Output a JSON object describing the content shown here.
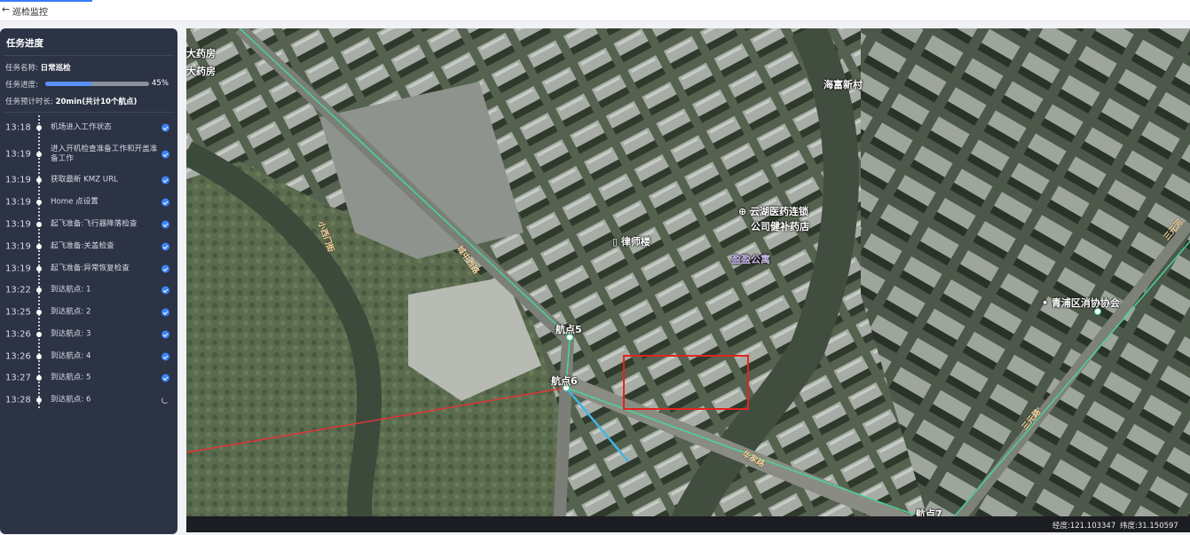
{
  "header": {
    "back_icon": "arrow-left-icon",
    "title": "巡检监控",
    "accent_color": "#3a7bfa"
  },
  "panel": {
    "title": "任务进度",
    "task_name_label": "任务名称:",
    "task_name": "日常巡检",
    "progress_label": "任务进度:",
    "progress_value": 0.45,
    "progress_text": "45%",
    "duration_label": "任务预计时长:",
    "duration_value": "20min(共计10个航点)",
    "steps": [
      {
        "time": "13:18",
        "label": "机场进入工作状态",
        "status": "done"
      },
      {
        "time": "13:19",
        "label": "进入开机检查准备工作和开盖准备工作",
        "status": "done"
      },
      {
        "time": "13:19",
        "label": "获取最新 KMZ URL",
        "status": "done"
      },
      {
        "time": "13:19",
        "label": "Home 点设置",
        "status": "done"
      },
      {
        "time": "13:19",
        "label": "起飞准备:飞行器降落检查",
        "status": "done"
      },
      {
        "time": "13:19",
        "label": "起飞准备:关盖检查",
        "status": "done"
      },
      {
        "time": "13:19",
        "label": "起飞准备:异常恢复检查",
        "status": "done"
      },
      {
        "time": "13:22",
        "label": "到达航点: 1",
        "status": "done"
      },
      {
        "time": "13:25",
        "label": "到达航点: 2",
        "status": "done"
      },
      {
        "time": "13:26",
        "label": "到达航点: 3",
        "status": "done"
      },
      {
        "time": "13:26",
        "label": "到达航点: 4",
        "status": "done"
      },
      {
        "time": "13:27",
        "label": "到达航点: 5",
        "status": "done"
      },
      {
        "time": "13:28",
        "label": "到达航点: 6",
        "status": "in-progress"
      }
    ],
    "check_color": "#3a82f7"
  },
  "map": {
    "poi_labels": {
      "pharmacy_top_left_1": "大药房",
      "pharmacy_top_left_2": "大药房",
      "haiyun_village": "海富新村",
      "yunhu_pharmacy_1": "云湖医药连锁",
      "yunhu_pharmacy_2": "公司健补药店",
      "law_building": "律师楼",
      "apartment": "盈盈公寓",
      "association": "• 青浦区消协协会",
      "waypoint_5": "航点5",
      "waypoint_6": "航点6",
      "waypoint_7": "航点7"
    },
    "road_labels": {
      "road_1": "小西门街",
      "road_2": "城中西路",
      "road_3": "华家路",
      "road_4": "三元河",
      "road_5": "三元路"
    },
    "route_colors": {
      "planned": "#49d49a",
      "flown": "#e03535",
      "heading": "#41b6e6"
    },
    "target_color": "#e0261e",
    "coordinates": {
      "lng": "经度:121.103347",
      "lat": "纬度:31.150597"
    }
  }
}
